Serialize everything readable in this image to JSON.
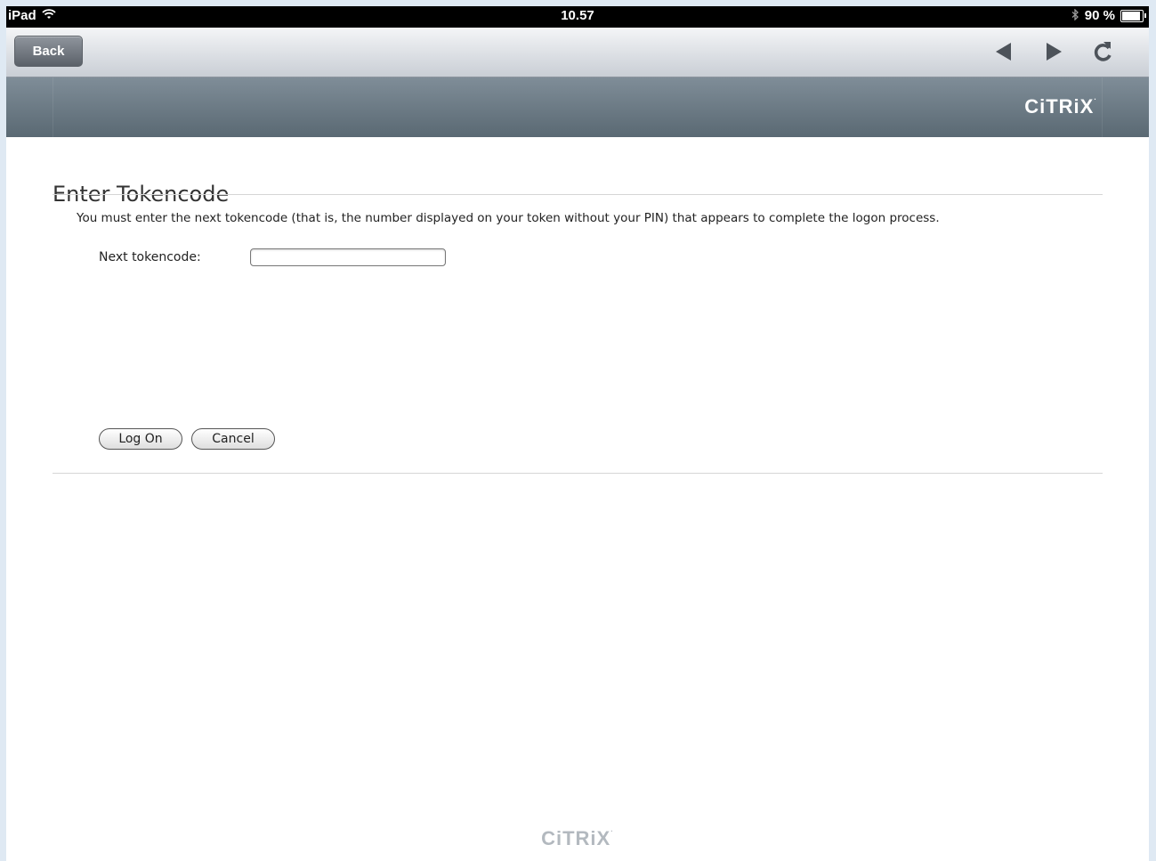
{
  "status_bar": {
    "device": "iPad",
    "time": "10.57",
    "battery_text": "90 %",
    "battery_level": 0.9,
    "wifi_icon": "wifi-icon",
    "bluetooth_icon": "bluetooth-icon"
  },
  "toolbar": {
    "back_label": "Back",
    "icons": [
      "back-arrow-icon",
      "forward-arrow-icon",
      "reload-icon"
    ]
  },
  "header": {
    "logo_text": "CiTRiX"
  },
  "main": {
    "title": "Enter Tokencode",
    "instruction": "You must enter the next tokencode (that is, the number displayed on your token without your PIN) that appears to complete the logon process.",
    "field_label": "Next tokencode:",
    "field_value": "",
    "logon_label": "Log On",
    "cancel_label": "Cancel"
  },
  "footer": {
    "logo_text": "CiTRiX"
  },
  "colors": {
    "header_band": "#6f7e89",
    "toolbar_top": "#f4f5f7",
    "toolbar_bottom": "#c9ced5",
    "footer_logo": "#b3b9bf"
  }
}
